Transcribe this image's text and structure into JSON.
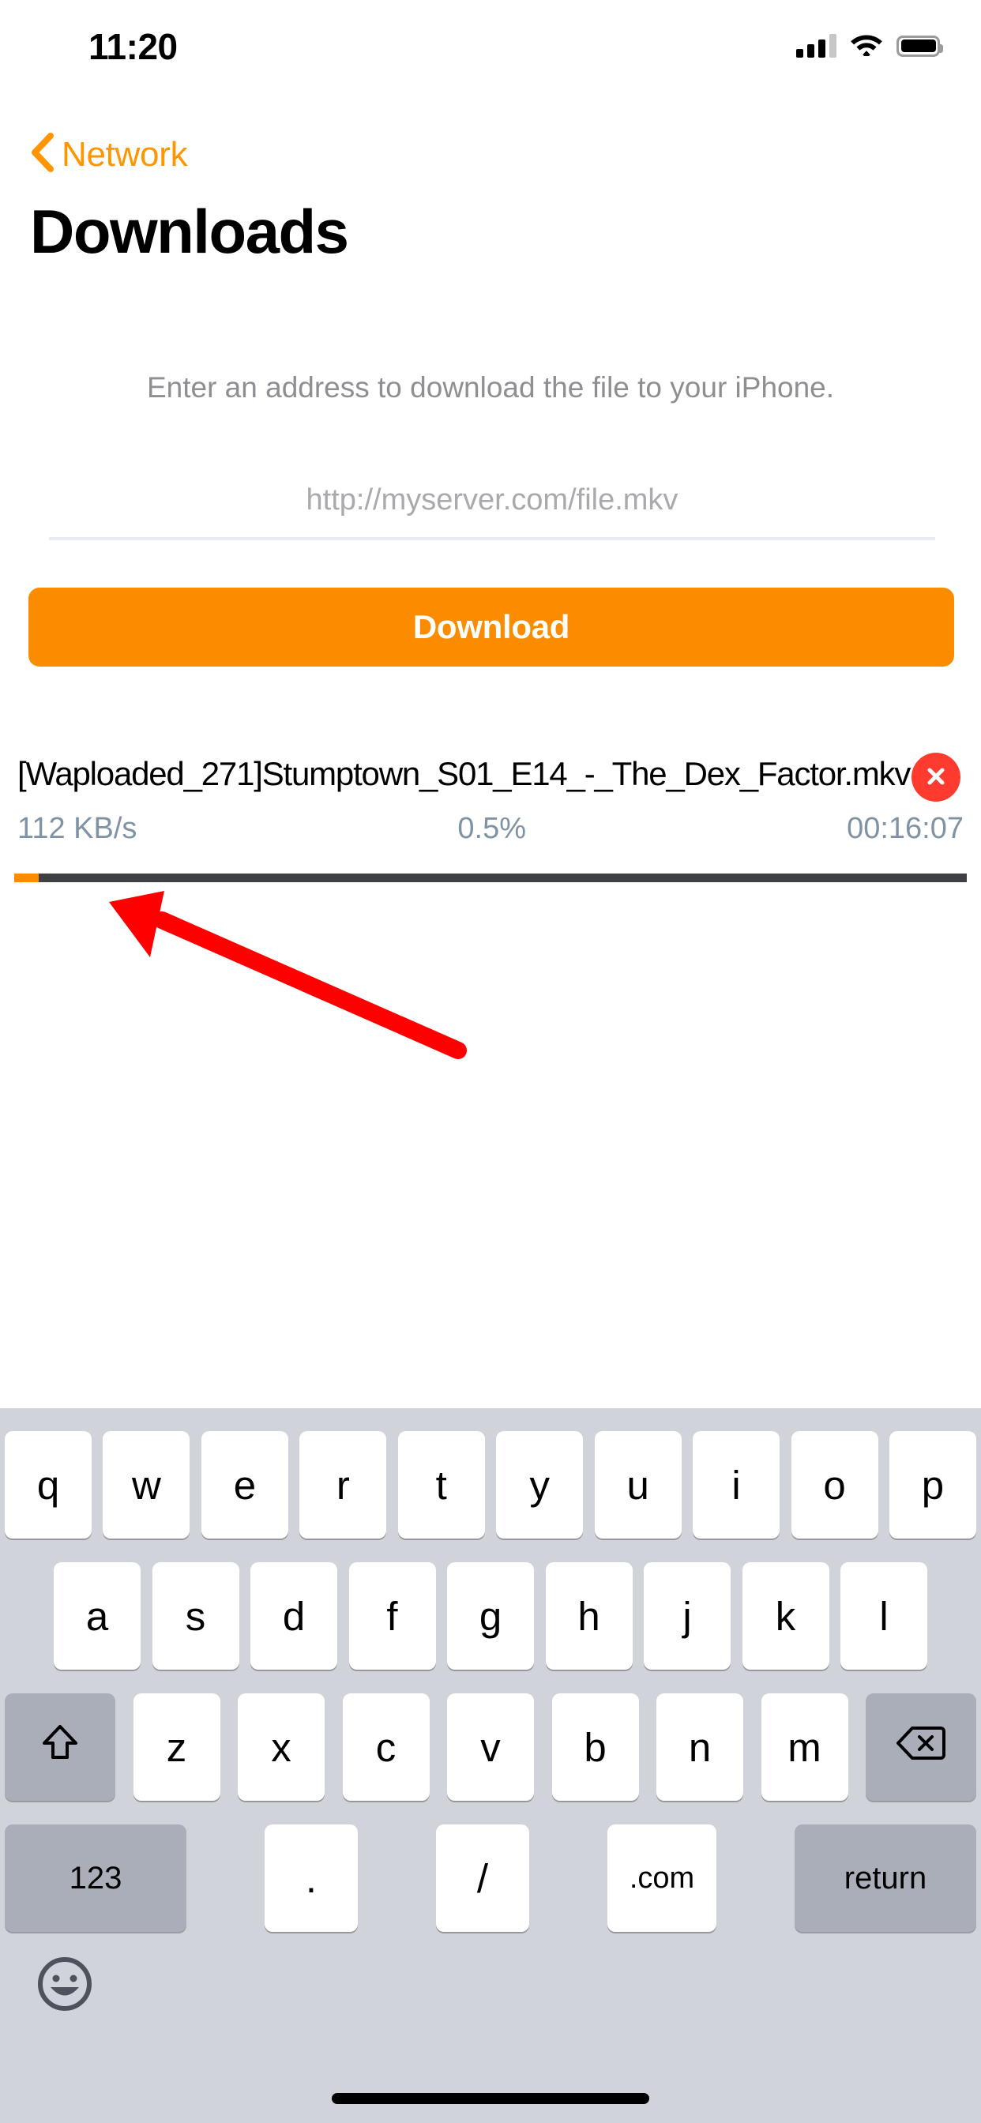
{
  "status_bar": {
    "time": "11:20",
    "cellular_icon": "cellular-signal-icon",
    "cellular_bars_filled": 3,
    "cellular_bars_total": 4,
    "wifi_icon": "wifi-icon",
    "battery_icon": "battery-full-icon"
  },
  "navigation": {
    "back_label": "Network",
    "back_icon": "chevron-left-icon",
    "accent_color": "#FF9500"
  },
  "header": {
    "title": "Downloads"
  },
  "main": {
    "subtitle": "Enter an address to download the file to your iPhone.",
    "url_field": {
      "value": "",
      "placeholder": "http://myserver.com/file.mkv"
    },
    "download_button": {
      "label": "Download",
      "color": "#FB8C00"
    }
  },
  "download_item": {
    "filename": "[Waploaded_271]Stumptown_S01_E14_-_The_Dex_Factor.mkv",
    "cancel_icon": "close-x-icon",
    "cancel_color": "#FF3B30",
    "speed": "112 KB/s",
    "percent": "0.5%",
    "time_remaining": "00:16:07",
    "progress_value": 0.5,
    "progress_fill_color": "#FB8C00",
    "progress_track_color": "#3E4044"
  },
  "annotation": {
    "arrow_icon": "red-arrow-pointing-to-progress-bar",
    "color": "#FF0000"
  },
  "keyboard": {
    "row1": [
      "q",
      "w",
      "e",
      "r",
      "t",
      "y",
      "u",
      "i",
      "o",
      "p"
    ],
    "row2": [
      "a",
      "s",
      "d",
      "f",
      "g",
      "h",
      "j",
      "k",
      "l"
    ],
    "row3_letters": [
      "z",
      "x",
      "c",
      "v",
      "b",
      "n",
      "m"
    ],
    "shift_icon": "shift-arrow-up-icon",
    "delete_icon": "backspace-delete-icon",
    "numbers_label": "123",
    "period_label": ".",
    "slash_label": "/",
    "dotcom_label": ".com",
    "return_label": "return",
    "emoji_icon": "emoji-smiley-icon",
    "background_color": "#D1D3DA"
  },
  "home_indicator": {
    "icon": "home-indicator-bar"
  }
}
